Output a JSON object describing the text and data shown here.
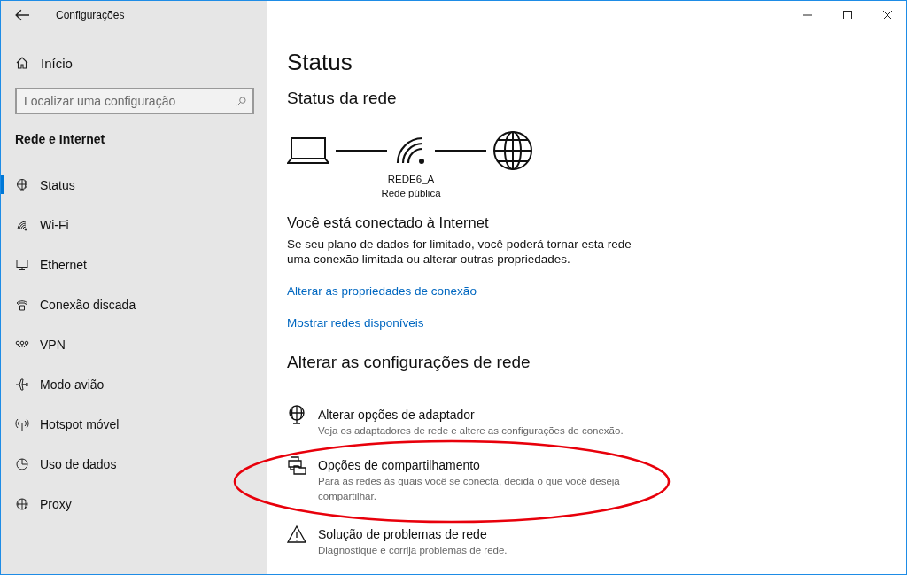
{
  "window": {
    "title": "Configurações"
  },
  "sidebar": {
    "home": "Início",
    "search": {
      "placeholder": "Localizar uma configuração"
    },
    "section": "Rede e Internet",
    "items": [
      {
        "label": "Status",
        "selected": true
      },
      {
        "label": "Wi-Fi",
        "selected": false
      },
      {
        "label": "Ethernet",
        "selected": false
      },
      {
        "label": "Conexão discada",
        "selected": false
      },
      {
        "label": "VPN",
        "selected": false
      },
      {
        "label": "Modo avião",
        "selected": false
      },
      {
        "label": "Hotspot móvel",
        "selected": false
      },
      {
        "label": "Uso de dados",
        "selected": false
      },
      {
        "label": "Proxy",
        "selected": false
      }
    ]
  },
  "main": {
    "title": "Status",
    "network_heading": "Status da rede",
    "network": {
      "name": "REDE6_A",
      "type": "Rede pública"
    },
    "connected_title": "Você está conectado à Internet",
    "connected_text": "Se seu plano de dados for limitado, você poderá tornar esta rede uma conexão limitada ou alterar outras propriedades.",
    "links": [
      "Alterar as propriedades de conexão",
      "Mostrar redes disponíveis"
    ],
    "change_heading": "Alterar as configurações de rede",
    "options": [
      {
        "title": "Alterar opções de adaptador",
        "description": "Veja os adaptadores de rede e altere as configurações de conexão."
      },
      {
        "title": "Opções de compartilhamento",
        "description": "Para as redes às quais você se conecta, decida o que você deseja compartilhar.",
        "highlighted": true
      },
      {
        "title": "Solução de problemas de rede",
        "description": "Diagnostique e corrija problemas de rede."
      }
    ]
  }
}
